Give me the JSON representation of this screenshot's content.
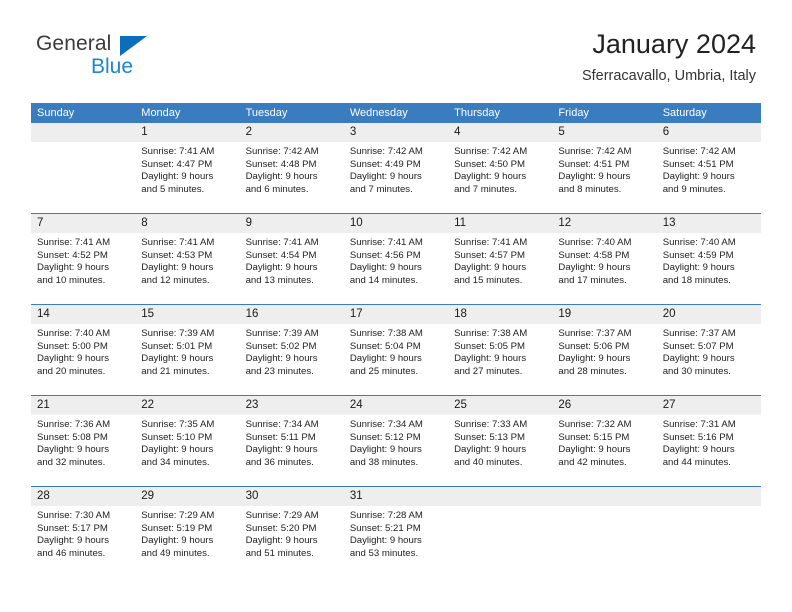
{
  "brand": {
    "name_part1": "General",
    "name_part2": "Blue"
  },
  "header": {
    "title": "January 2024",
    "location": "Sferracavallo, Umbria, Italy"
  },
  "calendar": {
    "day_headers": [
      "Sunday",
      "Monday",
      "Tuesday",
      "Wednesday",
      "Thursday",
      "Friday",
      "Saturday"
    ],
    "colors": {
      "header_blue": "#3a7cc0",
      "date_band_gray": "#eeeeee",
      "logo_blue": "#1b86d4",
      "logo_dark": "#3b3b3b",
      "text": "#222222"
    },
    "weeks": [
      [
        {
          "date": "",
          "sunrise": "",
          "sunset": "",
          "daylight_line1": "",
          "daylight_line2": ""
        },
        {
          "date": "1",
          "sunrise": "Sunrise: 7:41 AM",
          "sunset": "Sunset: 4:47 PM",
          "daylight_line1": "Daylight: 9 hours",
          "daylight_line2": "and 5 minutes."
        },
        {
          "date": "2",
          "sunrise": "Sunrise: 7:42 AM",
          "sunset": "Sunset: 4:48 PM",
          "daylight_line1": "Daylight: 9 hours",
          "daylight_line2": "and 6 minutes."
        },
        {
          "date": "3",
          "sunrise": "Sunrise: 7:42 AM",
          "sunset": "Sunset: 4:49 PM",
          "daylight_line1": "Daylight: 9 hours",
          "daylight_line2": "and 7 minutes."
        },
        {
          "date": "4",
          "sunrise": "Sunrise: 7:42 AM",
          "sunset": "Sunset: 4:50 PM",
          "daylight_line1": "Daylight: 9 hours",
          "daylight_line2": "and 7 minutes."
        },
        {
          "date": "5",
          "sunrise": "Sunrise: 7:42 AM",
          "sunset": "Sunset: 4:51 PM",
          "daylight_line1": "Daylight: 9 hours",
          "daylight_line2": "and 8 minutes."
        },
        {
          "date": "6",
          "sunrise": "Sunrise: 7:42 AM",
          "sunset": "Sunset: 4:51 PM",
          "daylight_line1": "Daylight: 9 hours",
          "daylight_line2": "and 9 minutes."
        }
      ],
      [
        {
          "date": "7",
          "sunrise": "Sunrise: 7:41 AM",
          "sunset": "Sunset: 4:52 PM",
          "daylight_line1": "Daylight: 9 hours",
          "daylight_line2": "and 10 minutes."
        },
        {
          "date": "8",
          "sunrise": "Sunrise: 7:41 AM",
          "sunset": "Sunset: 4:53 PM",
          "daylight_line1": "Daylight: 9 hours",
          "daylight_line2": "and 12 minutes."
        },
        {
          "date": "9",
          "sunrise": "Sunrise: 7:41 AM",
          "sunset": "Sunset: 4:54 PM",
          "daylight_line1": "Daylight: 9 hours",
          "daylight_line2": "and 13 minutes."
        },
        {
          "date": "10",
          "sunrise": "Sunrise: 7:41 AM",
          "sunset": "Sunset: 4:56 PM",
          "daylight_line1": "Daylight: 9 hours",
          "daylight_line2": "and 14 minutes."
        },
        {
          "date": "11",
          "sunrise": "Sunrise: 7:41 AM",
          "sunset": "Sunset: 4:57 PM",
          "daylight_line1": "Daylight: 9 hours",
          "daylight_line2": "and 15 minutes."
        },
        {
          "date": "12",
          "sunrise": "Sunrise: 7:40 AM",
          "sunset": "Sunset: 4:58 PM",
          "daylight_line1": "Daylight: 9 hours",
          "daylight_line2": "and 17 minutes."
        },
        {
          "date": "13",
          "sunrise": "Sunrise: 7:40 AM",
          "sunset": "Sunset: 4:59 PM",
          "daylight_line1": "Daylight: 9 hours",
          "daylight_line2": "and 18 minutes."
        }
      ],
      [
        {
          "date": "14",
          "sunrise": "Sunrise: 7:40 AM",
          "sunset": "Sunset: 5:00 PM",
          "daylight_line1": "Daylight: 9 hours",
          "daylight_line2": "and 20 minutes."
        },
        {
          "date": "15",
          "sunrise": "Sunrise: 7:39 AM",
          "sunset": "Sunset: 5:01 PM",
          "daylight_line1": "Daylight: 9 hours",
          "daylight_line2": "and 21 minutes."
        },
        {
          "date": "16",
          "sunrise": "Sunrise: 7:39 AM",
          "sunset": "Sunset: 5:02 PM",
          "daylight_line1": "Daylight: 9 hours",
          "daylight_line2": "and 23 minutes."
        },
        {
          "date": "17",
          "sunrise": "Sunrise: 7:38 AM",
          "sunset": "Sunset: 5:04 PM",
          "daylight_line1": "Daylight: 9 hours",
          "daylight_line2": "and 25 minutes."
        },
        {
          "date": "18",
          "sunrise": "Sunrise: 7:38 AM",
          "sunset": "Sunset: 5:05 PM",
          "daylight_line1": "Daylight: 9 hours",
          "daylight_line2": "and 27 minutes."
        },
        {
          "date": "19",
          "sunrise": "Sunrise: 7:37 AM",
          "sunset": "Sunset: 5:06 PM",
          "daylight_line1": "Daylight: 9 hours",
          "daylight_line2": "and 28 minutes."
        },
        {
          "date": "20",
          "sunrise": "Sunrise: 7:37 AM",
          "sunset": "Sunset: 5:07 PM",
          "daylight_line1": "Daylight: 9 hours",
          "daylight_line2": "and 30 minutes."
        }
      ],
      [
        {
          "date": "21",
          "sunrise": "Sunrise: 7:36 AM",
          "sunset": "Sunset: 5:08 PM",
          "daylight_line1": "Daylight: 9 hours",
          "daylight_line2": "and 32 minutes."
        },
        {
          "date": "22",
          "sunrise": "Sunrise: 7:35 AM",
          "sunset": "Sunset: 5:10 PM",
          "daylight_line1": "Daylight: 9 hours",
          "daylight_line2": "and 34 minutes."
        },
        {
          "date": "23",
          "sunrise": "Sunrise: 7:34 AM",
          "sunset": "Sunset: 5:11 PM",
          "daylight_line1": "Daylight: 9 hours",
          "daylight_line2": "and 36 minutes."
        },
        {
          "date": "24",
          "sunrise": "Sunrise: 7:34 AM",
          "sunset": "Sunset: 5:12 PM",
          "daylight_line1": "Daylight: 9 hours",
          "daylight_line2": "and 38 minutes."
        },
        {
          "date": "25",
          "sunrise": "Sunrise: 7:33 AM",
          "sunset": "Sunset: 5:13 PM",
          "daylight_line1": "Daylight: 9 hours",
          "daylight_line2": "and 40 minutes."
        },
        {
          "date": "26",
          "sunrise": "Sunrise: 7:32 AM",
          "sunset": "Sunset: 5:15 PM",
          "daylight_line1": "Daylight: 9 hours",
          "daylight_line2": "and 42 minutes."
        },
        {
          "date": "27",
          "sunrise": "Sunrise: 7:31 AM",
          "sunset": "Sunset: 5:16 PM",
          "daylight_line1": "Daylight: 9 hours",
          "daylight_line2": "and 44 minutes."
        }
      ],
      [
        {
          "date": "28",
          "sunrise": "Sunrise: 7:30 AM",
          "sunset": "Sunset: 5:17 PM",
          "daylight_line1": "Daylight: 9 hours",
          "daylight_line2": "and 46 minutes."
        },
        {
          "date": "29",
          "sunrise": "Sunrise: 7:29 AM",
          "sunset": "Sunset: 5:19 PM",
          "daylight_line1": "Daylight: 9 hours",
          "daylight_line2": "and 49 minutes."
        },
        {
          "date": "30",
          "sunrise": "Sunrise: 7:29 AM",
          "sunset": "Sunset: 5:20 PM",
          "daylight_line1": "Daylight: 9 hours",
          "daylight_line2": "and 51 minutes."
        },
        {
          "date": "31",
          "sunrise": "Sunrise: 7:28 AM",
          "sunset": "Sunset: 5:21 PM",
          "daylight_line1": "Daylight: 9 hours",
          "daylight_line2": "and 53 minutes."
        },
        {
          "date": "",
          "sunrise": "",
          "sunset": "",
          "daylight_line1": "",
          "daylight_line2": ""
        },
        {
          "date": "",
          "sunrise": "",
          "sunset": "",
          "daylight_line1": "",
          "daylight_line2": ""
        },
        {
          "date": "",
          "sunrise": "",
          "sunset": "",
          "daylight_line1": "",
          "daylight_line2": ""
        }
      ]
    ]
  }
}
